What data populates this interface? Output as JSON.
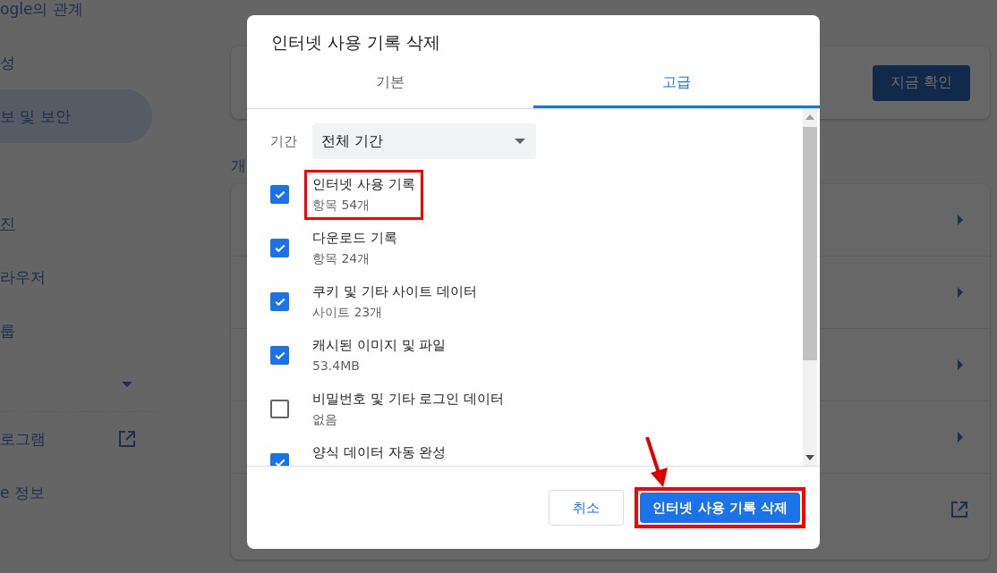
{
  "sidebar": {
    "sections": [
      {
        "items": [
          {
            "label": "ogle의 관계",
            "kind": "item",
            "selected": false
          },
          {
            "label": "성",
            "kind": "item",
            "selected": false
          },
          {
            "label": "보 및 보안",
            "kind": "item",
            "selected": true
          }
        ]
      },
      {
        "items": [
          {
            "label": "진",
            "kind": "item",
            "selected": false
          },
          {
            "label": "라우저",
            "kind": "item",
            "selected": false
          },
          {
            "label": "룹",
            "kind": "item",
            "selected": false
          },
          {
            "kind": "expander",
            "selected": false
          }
        ]
      },
      {
        "items": [
          {
            "label": "로그램",
            "kind": "external",
            "selected": false
          },
          {
            "label": "e 정보",
            "kind": "item",
            "selected": false
          }
        ]
      }
    ]
  },
  "main": {
    "check_button": "지금 확인",
    "privacy_heading": "개",
    "rows": [
      {
        "kind": "arrow"
      },
      {
        "kind": "arrow"
      },
      {
        "kind": "arrow"
      },
      {
        "kind": "arrow"
      },
      {
        "kind": "external"
      }
    ]
  },
  "dialog": {
    "title": "인터넷 사용 기록 삭제",
    "tabs": [
      {
        "label": "기본",
        "selected": false
      },
      {
        "label": "고급",
        "selected": true
      }
    ],
    "period": {
      "label": "기간",
      "value": "전체 기간"
    },
    "items": [
      {
        "label": "인터넷 사용 기록",
        "detail": "항목 54개",
        "checked": true,
        "highlighted": true
      },
      {
        "label": "다운로드 기록",
        "detail": "항목 24개",
        "checked": true,
        "highlighted": false
      },
      {
        "label": "쿠키 및 기타 사이트 데이터",
        "detail": "사이트 23개",
        "checked": true,
        "highlighted": false
      },
      {
        "label": "캐시된 이미지 및 파일",
        "detail": "53.4MB",
        "checked": true,
        "highlighted": false
      },
      {
        "label": "비밀번호 및 기타 로그인 데이터",
        "detail": "없음",
        "checked": false,
        "highlighted": false
      },
      {
        "label": "양식 데이터 자동 완성",
        "checked": true,
        "highlighted": false
      }
    ],
    "buttons": [
      {
        "label": "취소",
        "kind": "secondary",
        "highlighted": false,
        "pointer": false
      },
      {
        "label": "인터넷 사용 기록 삭제",
        "kind": "primary",
        "highlighted": true,
        "pointer": true
      }
    ]
  }
}
